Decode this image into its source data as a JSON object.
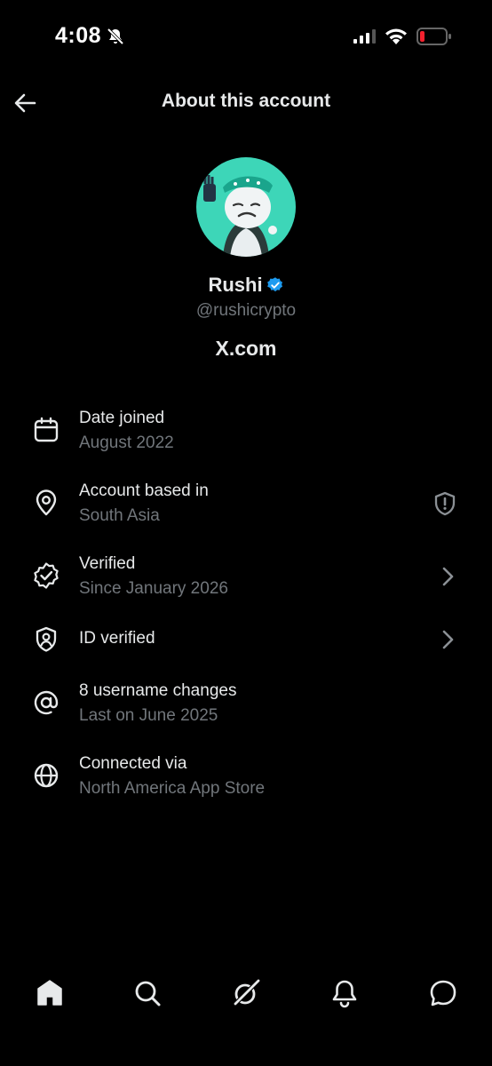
{
  "status_bar": {
    "time": "4:08"
  },
  "header": {
    "title": "About this account"
  },
  "profile": {
    "name": "Rushi",
    "handle": "@rushicrypto",
    "site": "X.com",
    "avatar_color": "#3dd6b8"
  },
  "details": [
    {
      "label": "Date joined",
      "value": "August 2022",
      "icon": "calendar-icon"
    },
    {
      "label": "Account based in",
      "value": "South Asia",
      "icon": "location-pin-icon",
      "right_icon": "shield-alert-icon"
    },
    {
      "label": "Verified",
      "value": "Since January 2026",
      "icon": "verified-badge-icon",
      "right_icon": "chevron-right-icon"
    },
    {
      "label": "ID verified",
      "value": "",
      "icon": "id-shield-icon",
      "right_icon": "chevron-right-icon"
    },
    {
      "label": "8 username changes",
      "value": "Last on June 2025",
      "icon": "at-sign-icon"
    },
    {
      "label": "Connected via",
      "value": "North America App Store",
      "icon": "globe-icon"
    }
  ],
  "colors": {
    "background": "#000000",
    "text": "#e7e9ea",
    "secondary": "#71767b",
    "verified_blue": "#1d9bf0",
    "battery_red": "#f4212e"
  },
  "tabbar": [
    "home-icon",
    "search-icon",
    "grok-icon",
    "notifications-icon",
    "messages-icon"
  ]
}
